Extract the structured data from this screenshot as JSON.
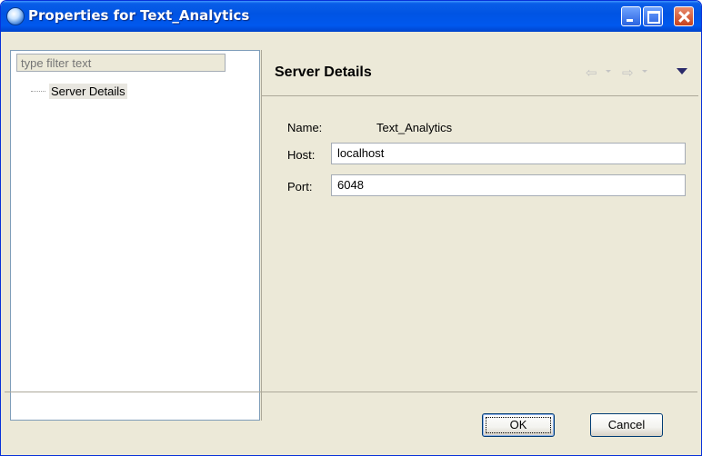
{
  "window": {
    "title": "Properties for Text_Analytics",
    "icon": "server-properties-icon"
  },
  "left_pane": {
    "filter_placeholder": "type filter text",
    "tree_items": [
      {
        "label": "Server Details",
        "selected": true
      }
    ]
  },
  "page": {
    "title": "Server Details",
    "name_label": "Name:",
    "name_value": "Text_Analytics",
    "host_label": "Host:",
    "host_value": "localhost",
    "port_label": "Port:",
    "port_value": "6048"
  },
  "buttons": {
    "ok_label": "OK",
    "cancel_label": "Cancel"
  },
  "colors": {
    "titlebar": "#0054e3",
    "dialog_bg": "#ece9d8",
    "disabled_nav": "#c4c4c4"
  }
}
